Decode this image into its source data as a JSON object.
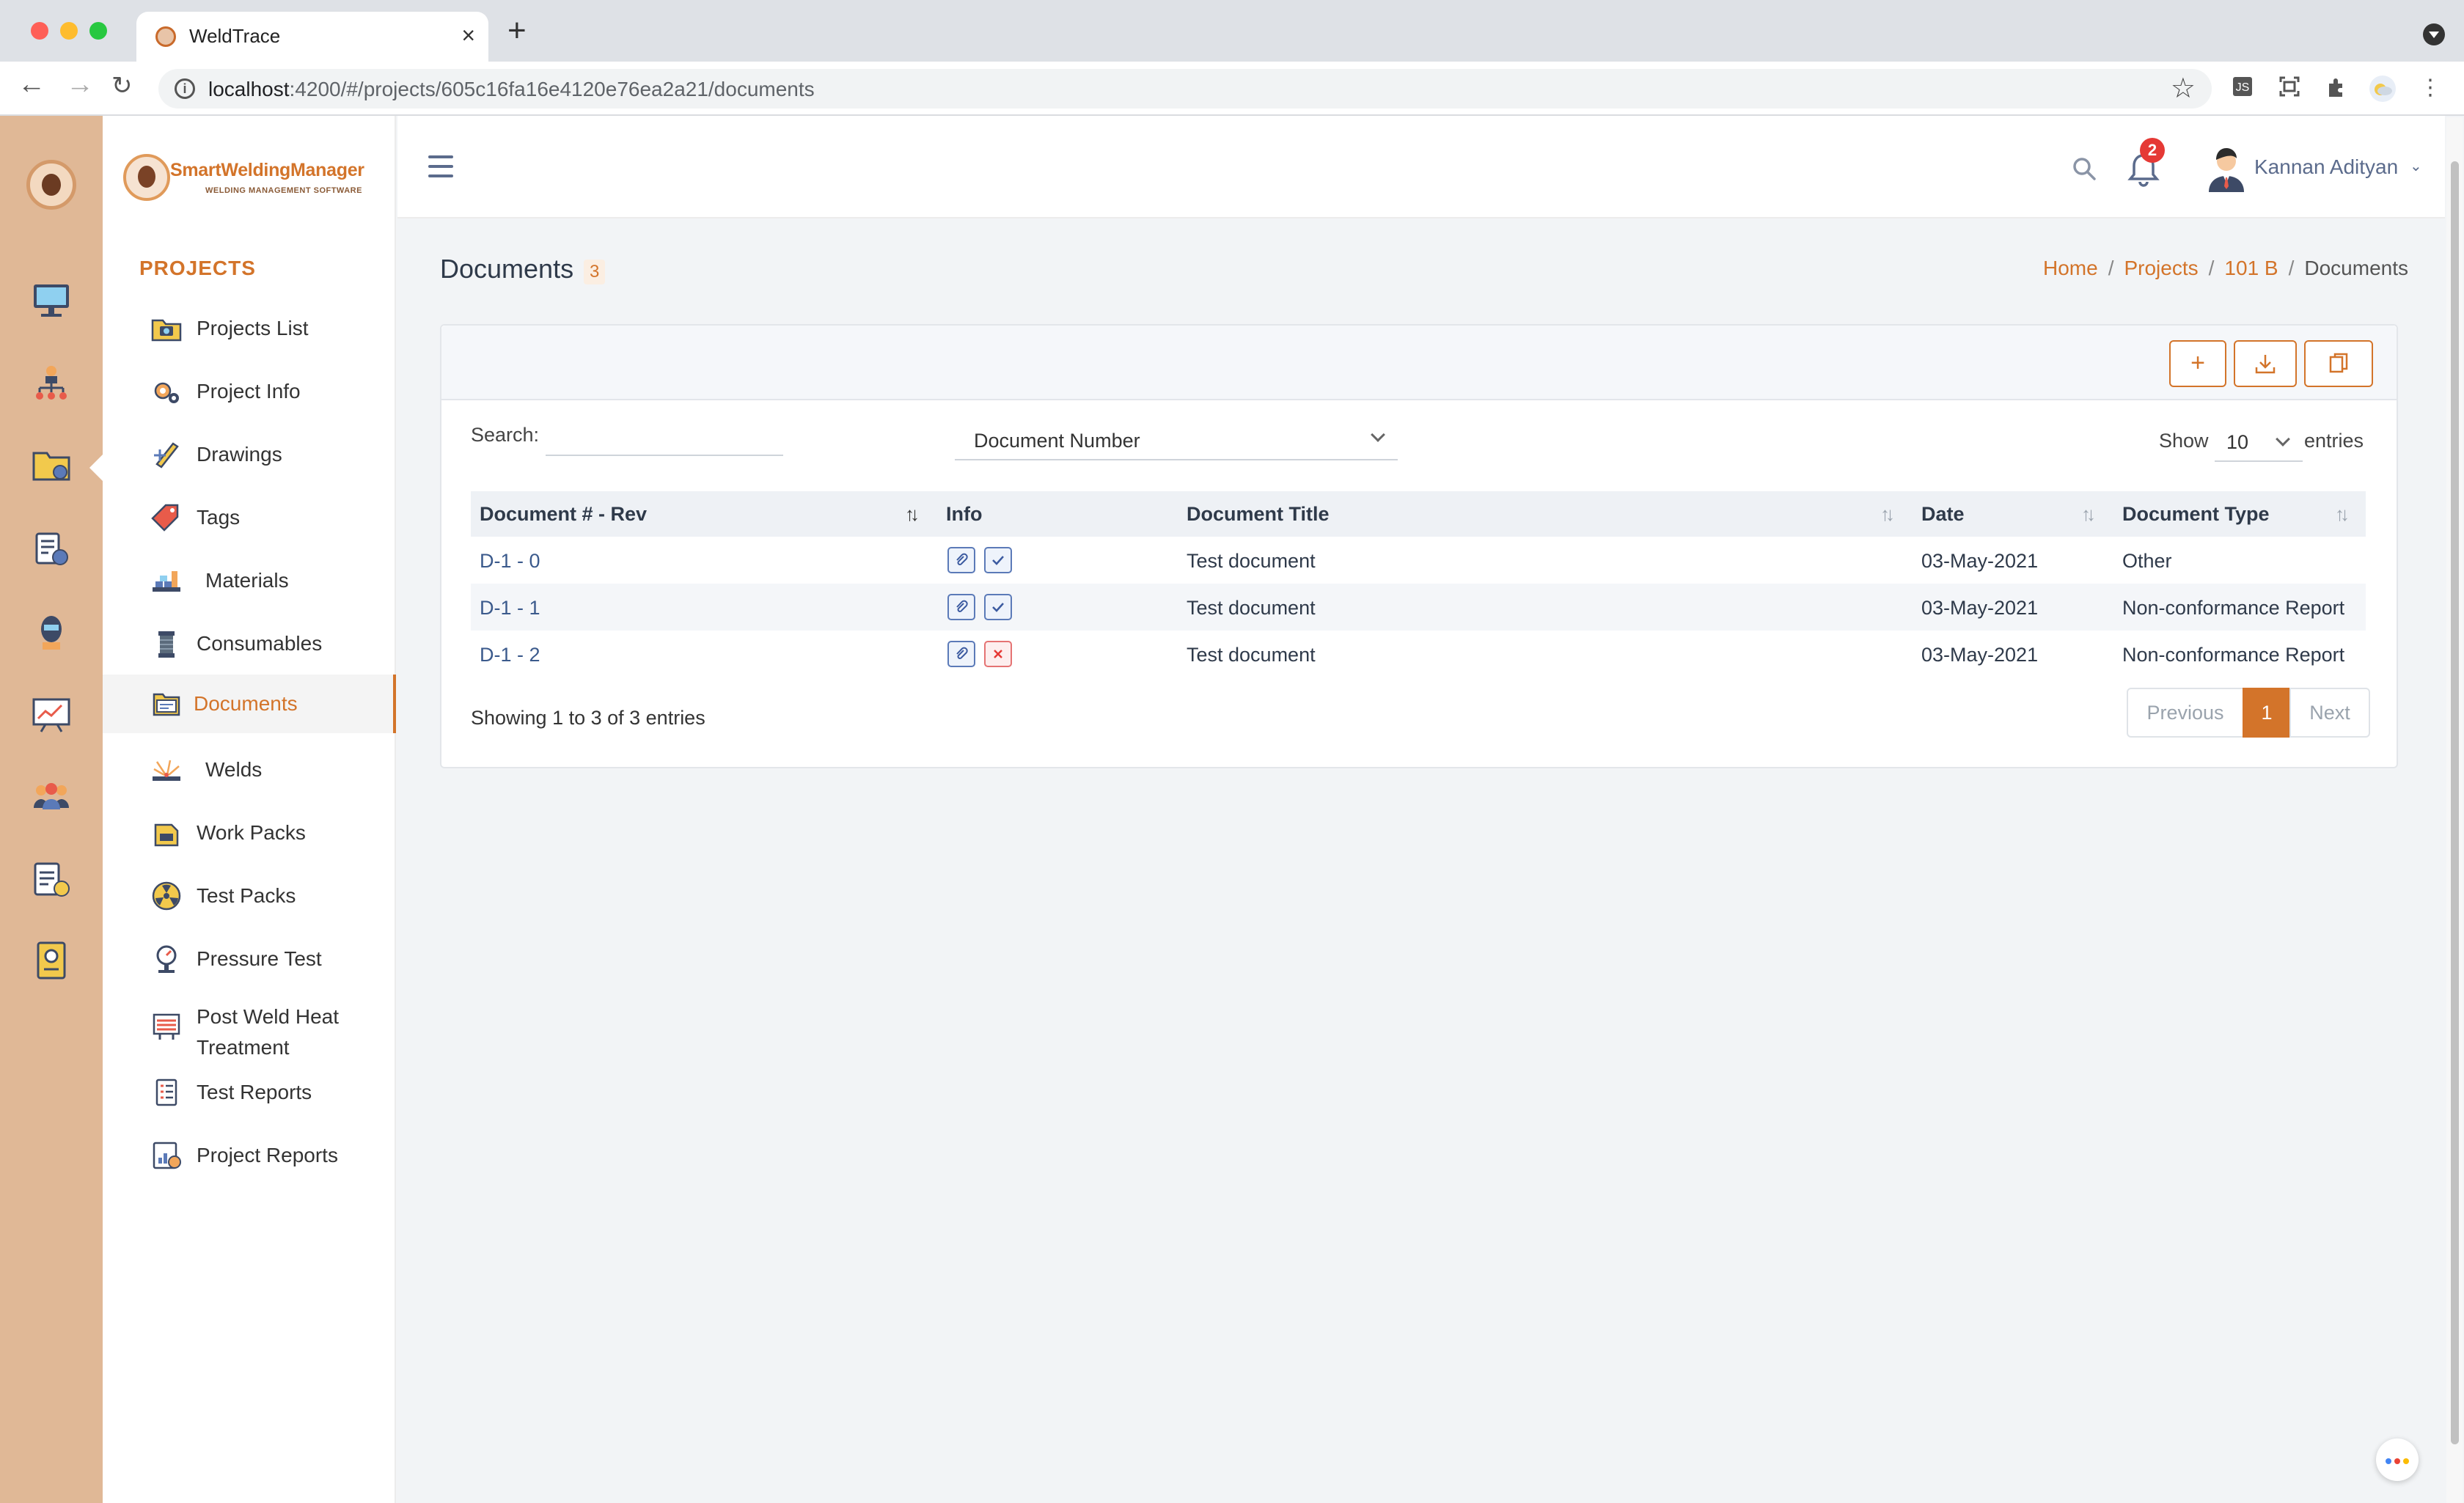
{
  "browser": {
    "tab_title": "WeldTrace",
    "url_host": "localhost",
    "url_rest": ":4200/#/projects/605c16fa16e4120e76ea2a21/documents"
  },
  "brand": {
    "name": "SmartWeldingManager",
    "tagline": "WELDING MANAGEMENT SOFTWARE"
  },
  "sidebar": {
    "section": "PROJECTS",
    "items": [
      {
        "label": "Projects List",
        "icon": "folder-camera-icon"
      },
      {
        "label": "Project Info",
        "icon": "gears-icon"
      },
      {
        "label": "Drawings",
        "icon": "drawing-icon"
      },
      {
        "label": "Tags",
        "icon": "tag-icon"
      },
      {
        "label": "Materials",
        "icon": "materials-icon"
      },
      {
        "label": "Consumables",
        "icon": "consumables-icon"
      },
      {
        "label": "Documents",
        "icon": "documents-icon"
      },
      {
        "label": "Welds",
        "icon": "weld-spark-icon"
      },
      {
        "label": "Work Packs",
        "icon": "work-pack-icon"
      },
      {
        "label": "Test Packs",
        "icon": "radiation-icon"
      },
      {
        "label": "Pressure Test",
        "icon": "pressure-gauge-icon"
      },
      {
        "label": "Post Weld Heat Treatment",
        "icon": "heat-treatment-icon"
      },
      {
        "label": "Test Reports",
        "icon": "checklist-icon"
      },
      {
        "label": "Project Reports",
        "icon": "report-chart-icon"
      }
    ]
  },
  "header": {
    "notification_count": "2",
    "user_name": "Kannan Adityan"
  },
  "page": {
    "title": "Documents",
    "count": "3",
    "breadcrumb": [
      "Home",
      "Projects",
      "101 B",
      "Documents"
    ]
  },
  "filters": {
    "search_label": "Search:",
    "search_value": "",
    "column_select": "Document Number",
    "show_label": "Show",
    "page_size": "10",
    "entries_label": "entries"
  },
  "table": {
    "columns": [
      "Document # - Rev",
      "Info",
      "Document Title",
      "Date",
      "Document Type"
    ],
    "rows": [
      {
        "doc": "D-1 - 0",
        "approved": true,
        "title": "Test document",
        "date": "03-May-2021",
        "type": "Other"
      },
      {
        "doc": "D-1 - 1",
        "approved": true,
        "title": "Test document",
        "date": "03-May-2021",
        "type": "Non-conformance Report"
      },
      {
        "doc": "D-1 - 2",
        "approved": false,
        "title": "Test document",
        "date": "03-May-2021",
        "type": "Non-conformance Report"
      }
    ]
  },
  "footer": {
    "info": "Showing 1 to 3 of 3 entries",
    "prev": "Previous",
    "current": "1",
    "next": "Next"
  },
  "colors": {
    "accent": "#d3742a",
    "rail": "#e0b896",
    "link": "#3b5a8c",
    "danger": "#e53935"
  }
}
